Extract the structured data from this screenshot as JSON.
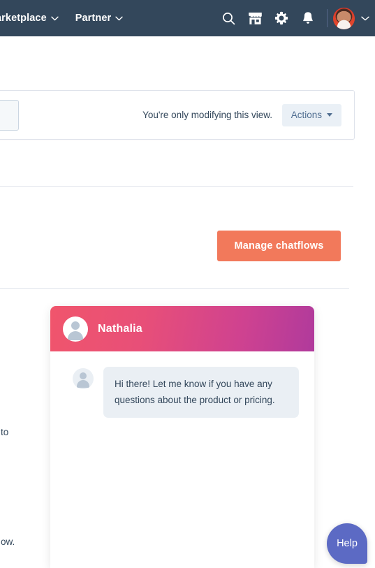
{
  "topbar": {
    "background": "#33475b",
    "nav_items": [
      {
        "label": "arketplace",
        "icon": "chevron-down-icon"
      },
      {
        "label": "Partner",
        "icon": "chevron-down-icon"
      }
    ],
    "icons": [
      {
        "name": "search-icon"
      },
      {
        "name": "marketplace-storefront-icon"
      },
      {
        "name": "settings-gear-icon"
      },
      {
        "name": "notifications-bell-icon"
      }
    ],
    "avatar": {
      "name": "user-avatar",
      "caret": "chevron-down-icon"
    }
  },
  "view_bar": {
    "select_value": "",
    "note": "You're only modifying this view.",
    "actions_label": "Actions",
    "actions_caret": "caret-down-icon"
  },
  "main": {
    "manage_button_label": "Manage chatflows",
    "manage_button_color": "#f2795b",
    "fragment_left_mid": "to",
    "fragment_left_bottom": "ow."
  },
  "chat_widget": {
    "header": {
      "agent_name": "Nathalia",
      "avatar": "person-avatar-icon",
      "gradient_from": "#f0556c",
      "gradient_to": "#b03a9c"
    },
    "messages": [
      {
        "avatar": "person-avatar-icon",
        "text": "Hi there! Let me know if you have any questions about the product or pricing."
      }
    ]
  },
  "help": {
    "label": "Help",
    "color": "#5c6ac4"
  }
}
